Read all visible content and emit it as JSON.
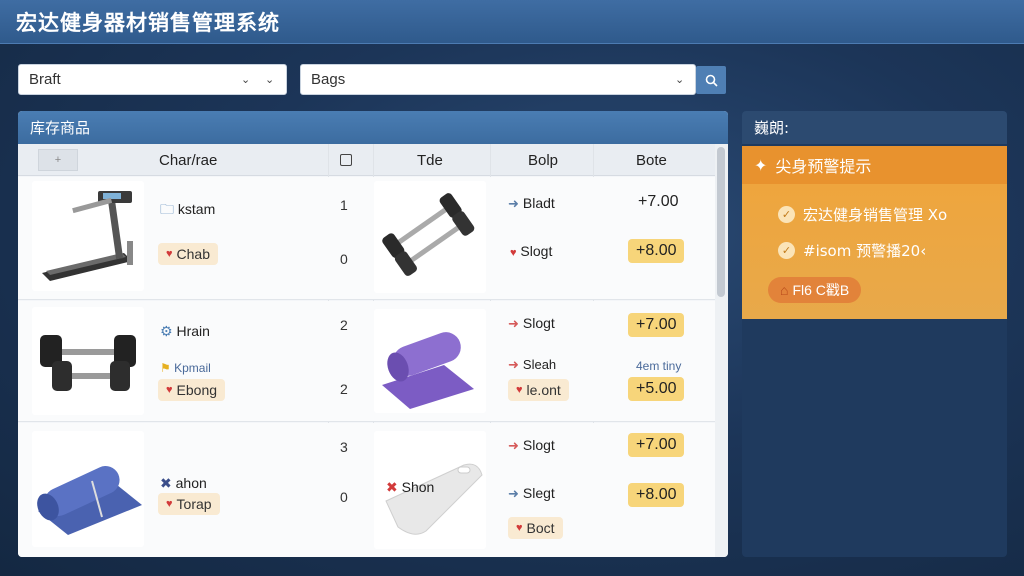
{
  "app": {
    "title": "宏达健身器材销售管理系统"
  },
  "filters": {
    "category_value": "Braft",
    "bag_value": "Bags",
    "search_icon": "search-icon"
  },
  "inventory": {
    "panel_title": "库存商品",
    "columns": [
      "Char/rae",
      "Tde",
      "Bolp",
      "Bote"
    ],
    "header_mark": "+",
    "rows": [
      {
        "product_image": "treadmill",
        "name": "kstam",
        "name_icon": "folder-icon",
        "tag": "Chab",
        "qty_top": "1",
        "qty_bottom": "0",
        "type_image": "dumbbells",
        "bolp_top": "Bladt",
        "bolp_bottom": "Slogt",
        "price_top": "+7.00",
        "price_bottom": "+8.00"
      },
      {
        "product_image": "dumbbells",
        "name": "Hrain",
        "name_icon": "settings-icon",
        "sub_label": "Kpmail",
        "tag": "Ebong",
        "qty_top": "2",
        "qty_bottom": "2",
        "type_image": "yoga-mat",
        "bolp_top": "Slogt",
        "bolp_mid": "Sleah",
        "bolp_tag": "le.ont",
        "price_top": "+7.00",
        "price_note": "4em tiny",
        "price_bottom": "+5.00"
      },
      {
        "product_image": "yoga-mat",
        "name": "ahon",
        "name_icon": "cross-icon",
        "tag": "Torap",
        "qty_top": "3",
        "qty_bottom": "0",
        "type_image": "balance-board",
        "type_label": "Shon",
        "bolp_top": "Slogt",
        "bolp_mid": "Slegt",
        "bolp_tag": "Boct",
        "price_top": "+7.00",
        "price_bottom": "+8.00"
      }
    ]
  },
  "sidebar": {
    "title": "巍朗:",
    "alert": {
      "title": "尖身预警提示",
      "items": [
        "宏达健身销售管理 Xo",
        "#isom 预警播20‹"
      ],
      "button_label": "Fl6 C戳B"
    }
  },
  "colors": {
    "accent": "#3c6ca0",
    "alert": "#f0a43a",
    "price_tag": "#f7d57a"
  }
}
